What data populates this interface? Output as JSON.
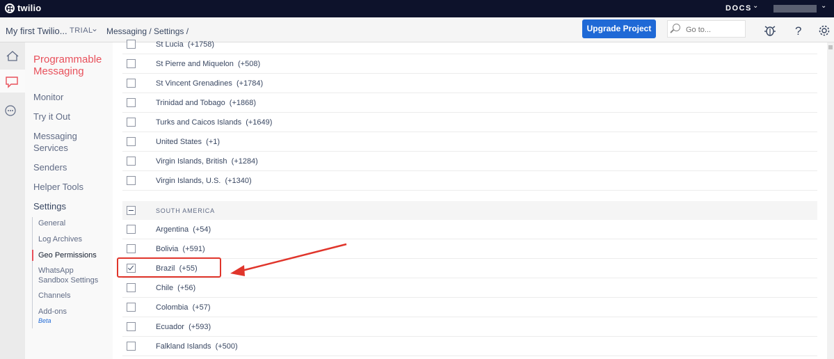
{
  "topbar": {
    "brand": "twilio",
    "docs_label": "DOCS"
  },
  "header": {
    "project_name": "My first Twilio...",
    "account_type": "TRIAL",
    "breadcrumb": "Messaging  /  Settings  /",
    "upgrade_label": "Upgrade Project",
    "search_placeholder": "Go to..."
  },
  "sidebar": {
    "product": "Programmable Messaging",
    "items": [
      "Monitor",
      "Try it Out",
      "Messaging Services",
      "Senders",
      "Helper Tools",
      "Settings"
    ],
    "settings_items": [
      "General",
      "Log Archives",
      "Geo Permissions",
      "WhatsApp Sandbox Settings",
      "Channels",
      "Add-ons"
    ],
    "beta_label": "Beta",
    "active_item": "Geo Permissions"
  },
  "countries_above": [
    {
      "label": "St Lucia  (+1758)",
      "checked": false
    },
    {
      "label": "St Pierre and Miquelon  (+508)",
      "checked": false
    },
    {
      "label": "St Vincent Grenadines  (+1784)",
      "checked": false
    },
    {
      "label": "Trinidad and Tobago  (+1868)",
      "checked": false
    },
    {
      "label": "Turks and Caicos Islands  (+1649)",
      "checked": false
    },
    {
      "label": "United States  (+1)",
      "checked": false
    },
    {
      "label": "Virgin Islands, British  (+1284)",
      "checked": false
    },
    {
      "label": "Virgin Islands, U.S.  (+1340)",
      "checked": false
    }
  ],
  "region": {
    "label": "SOUTH AMERICA"
  },
  "countries_south_america": [
    {
      "label": "Argentina  (+54)",
      "checked": false
    },
    {
      "label": "Bolivia  (+591)",
      "checked": false
    },
    {
      "label": "Brazil  (+55)",
      "checked": true
    },
    {
      "label": "Chile  (+56)",
      "checked": false
    },
    {
      "label": "Colombia  (+57)",
      "checked": false
    },
    {
      "label": "Ecuador  (+593)",
      "checked": false
    },
    {
      "label": "Falkland Islands  (+500)",
      "checked": false
    }
  ],
  "colors": {
    "brand_red": "#e8505b",
    "accent_blue": "#1f69d6",
    "annotation_red": "#e0352b"
  }
}
